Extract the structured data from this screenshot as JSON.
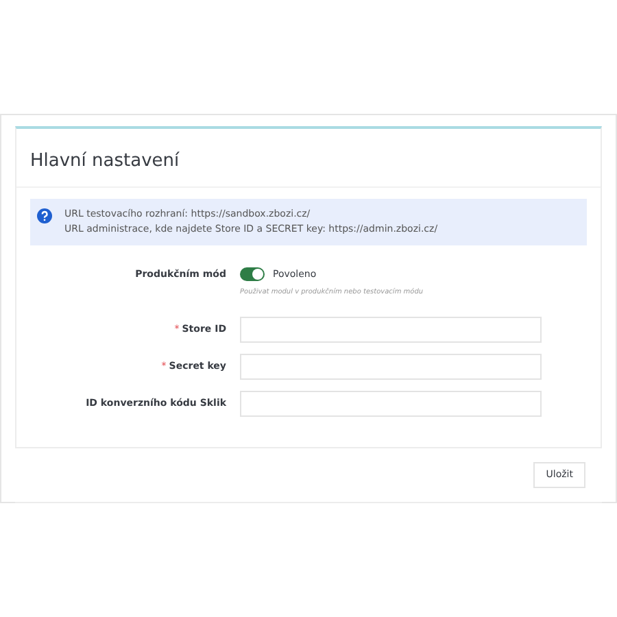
{
  "panel": {
    "title": "Hlavní nastavení"
  },
  "info": {
    "lines": [
      "URL testovacího rozhraní: https://sandbox.zbozi.cz/",
      "URL administrace, kde najdete Store ID a SECRET key: https://admin.zbozi.cz/"
    ]
  },
  "fields": [
    {
      "kind": "switch",
      "label": "Produkčním mód",
      "on": true,
      "value": "Povoleno",
      "help": "Použivat modul v produkčním nebo testovacím módu"
    },
    {
      "kind": "text",
      "label": "Store ID",
      "required_mark": "*"
    },
    {
      "kind": "text",
      "label": "Secret key",
      "required_mark": "*"
    },
    {
      "kind": "text",
      "label": "ID konverzního kódu Sklik"
    }
  ],
  "save_button": "Uložit"
}
